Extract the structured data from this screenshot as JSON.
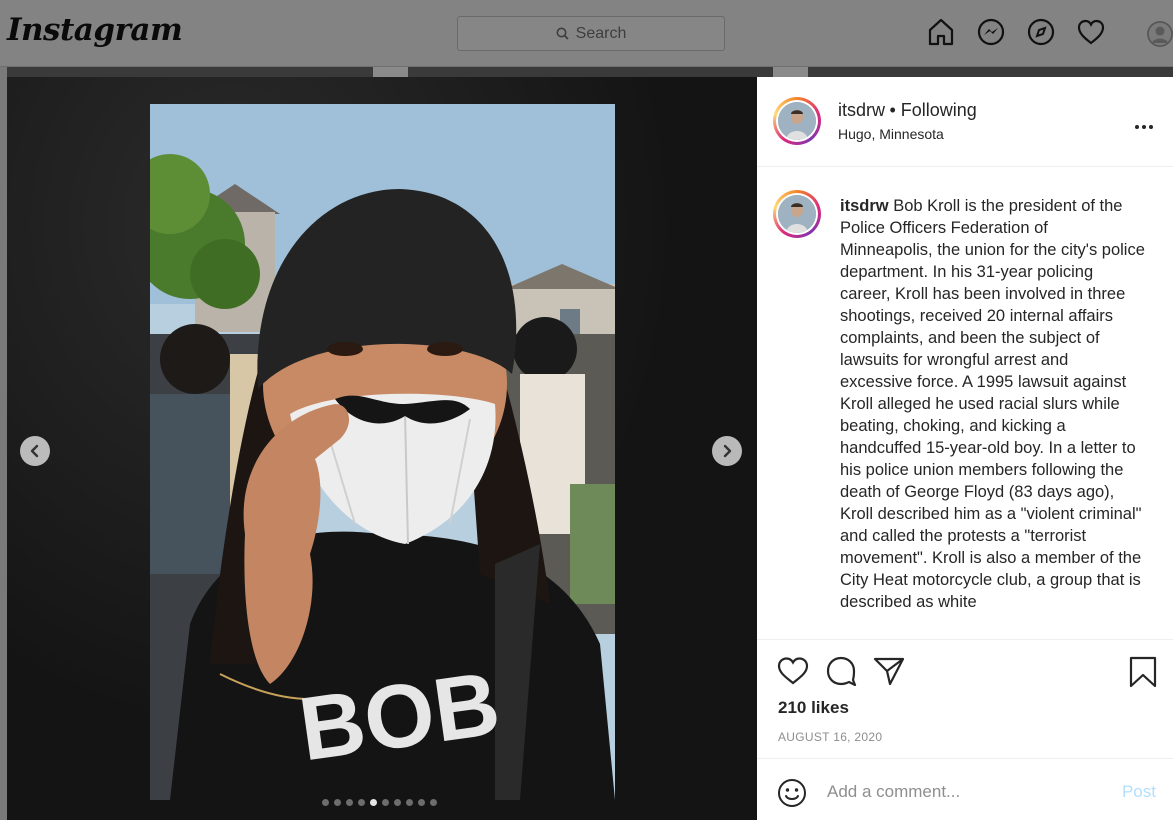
{
  "topnav": {
    "logo": "Instagram",
    "search_placeholder": "Search"
  },
  "post": {
    "username": "itsdrw",
    "following": "• Following",
    "location": "Hugo, Minnesota",
    "more": "•••",
    "caption_user": "itsdrw",
    "caption_text": "Bob Kroll is the president of the Police Officers Federation of Minneapolis, the union for the city's police department. In his 31-year policing career, Kroll has been involved in three shootings, received 20 internal affairs complaints, and been the subject of lawsuits for wrongful arrest and excessive force. A 1995 lawsuit against Kroll alleged he used racial slurs while beating, choking, and kicking a handcuffed 15-year-old boy. In a letter to his police union members following the death of George Floyd (83 days ago), Kroll described him as a \"violent criminal\" and called the protests a \"terrorist movement\". Kroll is also a member of the City Heat motorcycle club, a group that is described as white",
    "likes": "210 likes",
    "date": "AUGUST 16, 2020",
    "comment_placeholder": "Add a comment...",
    "post_button": "Post",
    "photo_shirt_text": "BOB",
    "carousel_total": 10,
    "carousel_active": 5
  },
  "colors": {
    "accent_post_disabled": "#b2dffc",
    "text": "#262626",
    "muted": "#8e8e8e"
  }
}
